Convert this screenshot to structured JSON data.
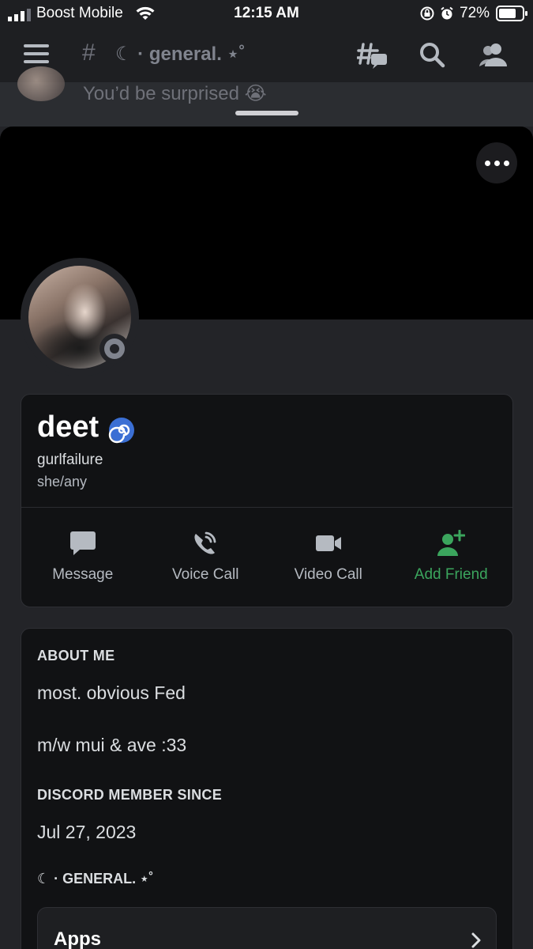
{
  "status_bar": {
    "carrier": "Boost Mobile",
    "time": "12:15 AM",
    "battery_percent": "72%",
    "icons": [
      "signal-icon",
      "wifi-icon",
      "rotation-lock-icon",
      "alarm-icon",
      "battery-icon"
    ]
  },
  "header": {
    "channel_prefix": "#",
    "channel_name": "☾ · general. ⋆˚",
    "icons": [
      "menu-icon",
      "threads-icon",
      "search-icon",
      "members-icon"
    ]
  },
  "chat_peek": {
    "message": "You’d be surprised 😭"
  },
  "profile": {
    "display_name": "deet",
    "name_emoji": "cyclone-emoji",
    "username": "gurlfailure",
    "pronouns": "she/any",
    "status": "idle",
    "actions": [
      {
        "label": "Message",
        "icon": "message-icon"
      },
      {
        "label": "Voice Call",
        "icon": "phone-icon"
      },
      {
        "label": "Video Call",
        "icon": "video-icon"
      },
      {
        "label": "Add Friend",
        "icon": "add-friend-icon"
      }
    ],
    "about_title": "ABOUT ME",
    "about_lines": [
      "most. obvious Fed",
      "m/w mui & ave :33"
    ],
    "member_since_title": "DISCORD MEMBER SINCE",
    "member_since": "Jul 27, 2023",
    "server_title": "☾ · GENERAL. ⋆˚",
    "apps_label": "Apps"
  },
  "colors": {
    "background": "#232428",
    "card": "#111214",
    "accent_green": "#3ba55d",
    "muted_text": "#b5bac1"
  }
}
